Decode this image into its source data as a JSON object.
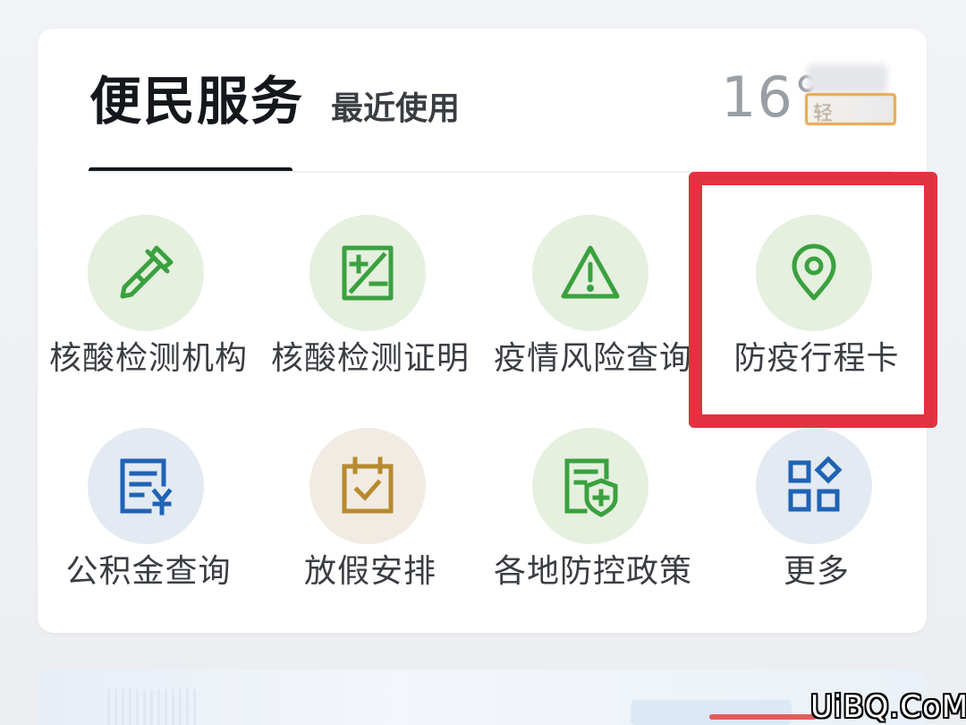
{
  "tabs": {
    "active": "便民服务",
    "recent": "最近使用"
  },
  "weather": {
    "temperature": "16°",
    "badge_text": "轻"
  },
  "services": [
    {
      "label": "核酸检测机构",
      "icon": "pipette-icon",
      "circle_color": "#e5f0df",
      "icon_color": "#3aa13f"
    },
    {
      "label": "核酸检测证明",
      "icon": "report-calc-icon",
      "circle_color": "#e5f0df",
      "icon_color": "#3aa13f"
    },
    {
      "label": "疫情风险查询",
      "icon": "warning-triangle-icon",
      "circle_color": "#e5f0df",
      "icon_color": "#3aa13f"
    },
    {
      "label": "防疫行程卡",
      "icon": "location-pin-icon",
      "circle_color": "#e5f0df",
      "icon_color": "#3aa13f"
    },
    {
      "label": "公积金查询",
      "icon": "document-yuan-icon",
      "circle_color": "#e3eaf2",
      "icon_color": "#1f63b4"
    },
    {
      "label": "放假安排",
      "icon": "calendar-check-icon",
      "circle_color": "#f1ebe3",
      "icon_color": "#b88a2e"
    },
    {
      "label": "各地防控政策",
      "icon": "shield-document-icon",
      "circle_color": "#e5f0df",
      "icon_color": "#3aa13f"
    },
    {
      "label": "更多",
      "icon": "grid-apps-icon",
      "circle_color": "#e3eaf2",
      "icon_color": "#1f63b4"
    }
  ],
  "highlight": {
    "target": "防疫行程卡",
    "color": "#e2323f"
  },
  "watermark": "UiBQ.CoM"
}
